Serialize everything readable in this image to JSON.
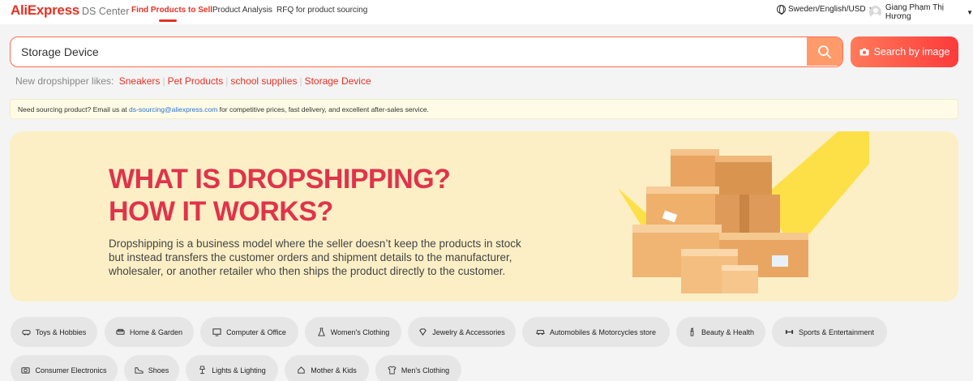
{
  "header": {
    "logo": "AliExpress",
    "center": "DS Center",
    "nav": [
      {
        "label": "Find Products to Sell",
        "active": true
      },
      {
        "label": "Product Analysis",
        "active": false
      },
      {
        "label": "RFQ for product sourcing",
        "active": false
      }
    ],
    "locale": "Sweden/English/USD",
    "user": "Giang Phạm Thị Hương"
  },
  "search": {
    "value": "Storage Device",
    "image_button": "Search by image"
  },
  "likes": {
    "label": "New dropshipper likes:",
    "items": [
      "Sneakers",
      "Pet Products",
      "school supplies",
      "Storage Device"
    ]
  },
  "notice": {
    "before": "Need sourcing product? Email us at ",
    "email": "ds-sourcing@aliexpress.com",
    "after": " for competitive prices, fast delivery, and excellent after-sales service."
  },
  "banner": {
    "title_line1": "WHAT IS DROPSHIPPING?",
    "title_line2": "HOW IT WORKS?",
    "description": "Dropshipping is a business model where the seller doesn’t keep the products in stock but instead transfers the customer orders and shipment details to the manufacturer, wholesaler, or another retailer who then ships the product directly to the customer."
  },
  "categories": [
    {
      "label": "Toys & Hobbies",
      "icon": "car-toy-icon"
    },
    {
      "label": "Home & Garden",
      "icon": "sofa-icon"
    },
    {
      "label": "Computer & Office",
      "icon": "monitor-icon"
    },
    {
      "label": "Women's Clothing",
      "icon": "dress-icon"
    },
    {
      "label": "Jewelry & Accessories",
      "icon": "gem-icon"
    },
    {
      "label": "Automobiles & Motorcycles store",
      "icon": "car-icon"
    },
    {
      "label": "Beauty & Health",
      "icon": "lipstick-icon"
    },
    {
      "label": "Sports & Entertainment",
      "icon": "dumbbell-icon"
    },
    {
      "label": "Consumer Electronics",
      "icon": "camera-icon"
    },
    {
      "label": "Shoes",
      "icon": "shoe-icon"
    },
    {
      "label": "Lights & Lighting",
      "icon": "lamp-icon"
    },
    {
      "label": "Mother & Kids",
      "icon": "baby-icon"
    },
    {
      "label": "Men's Clothing",
      "icon": "shirt-icon"
    }
  ],
  "colors": {
    "accent": "#e43225",
    "banner_bg": "#fcefc6",
    "banner_title": "#e0334a"
  }
}
